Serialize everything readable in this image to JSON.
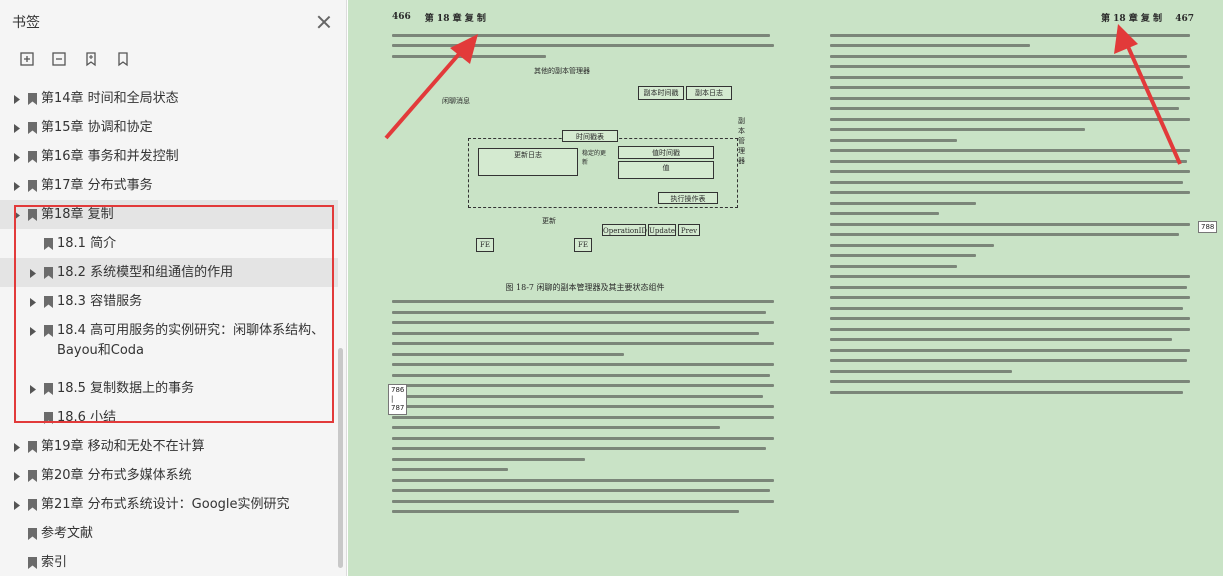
{
  "sidebar": {
    "title": "书签",
    "toc": [
      {
        "label": "第14章 时间和全局状态",
        "level": 0,
        "expandable": true
      },
      {
        "label": "第15章 协调和协定",
        "level": 0,
        "expandable": true
      },
      {
        "label": "第16章 事务和并发控制",
        "level": 0,
        "expandable": true
      },
      {
        "label": "第17章 分布式事务",
        "level": 0,
        "expandable": true
      },
      {
        "label": "第18章 复制",
        "level": 0,
        "expandable": true,
        "expanded": true
      },
      {
        "label": "18.1 简介",
        "level": 1,
        "expandable": false
      },
      {
        "label": "18.2 系统模型和组通信的作用",
        "level": 1,
        "expandable": true
      },
      {
        "label": "18.3 容错服务",
        "level": 1,
        "expandable": true
      },
      {
        "label": "18.4 高可用服务的实例研究：闲聊体系结构、Bayou和Coda",
        "level": 1,
        "expandable": true
      },
      {
        "label": "18.5 复制数据上的事务",
        "level": 1,
        "expandable": true
      },
      {
        "label": "18.6 小结",
        "level": 1,
        "expandable": false
      },
      {
        "label": "第19章 移动和无处不在计算",
        "level": 0,
        "expandable": true
      },
      {
        "label": "第20章 分布式多媒体系统",
        "level": 0,
        "expandable": true
      },
      {
        "label": "第21章 分布式系统设计：Google实例研究",
        "level": 0,
        "expandable": true
      },
      {
        "label": "参考文献",
        "level": 0,
        "expandable": false
      },
      {
        "label": "索引",
        "level": 0,
        "expandable": false
      }
    ]
  },
  "left_page": {
    "number": "466",
    "chapter": "第 18 章  复    制",
    "figure_labels": {
      "other_rm": "其他的副本管理器",
      "gossip": "闲聊消息",
      "replica_ts": "副本时间戳",
      "replica_log": "副本日志",
      "rm": "副本管理器",
      "timestamp_table": "时间戳表",
      "update_log": "更新日志",
      "stable_update": "稳定的更新",
      "value_ts": "值时间戳",
      "value": "值",
      "executed_ops": "执行操作表",
      "updates": "更新",
      "fe": "FE",
      "op_id": "OperationID",
      "update": "Update",
      "prev": "Prev"
    },
    "caption": "图 18-7   闲聊的副本管理器及其主要状态组件",
    "margin_number": "786\n|\n787"
  },
  "right_page": {
    "number": "467",
    "chapter": "第 18 章  复    制",
    "margin_number": "788"
  },
  "colors": {
    "annotation": "#e23a3a",
    "reader_bg": "#c9e3c6"
  }
}
